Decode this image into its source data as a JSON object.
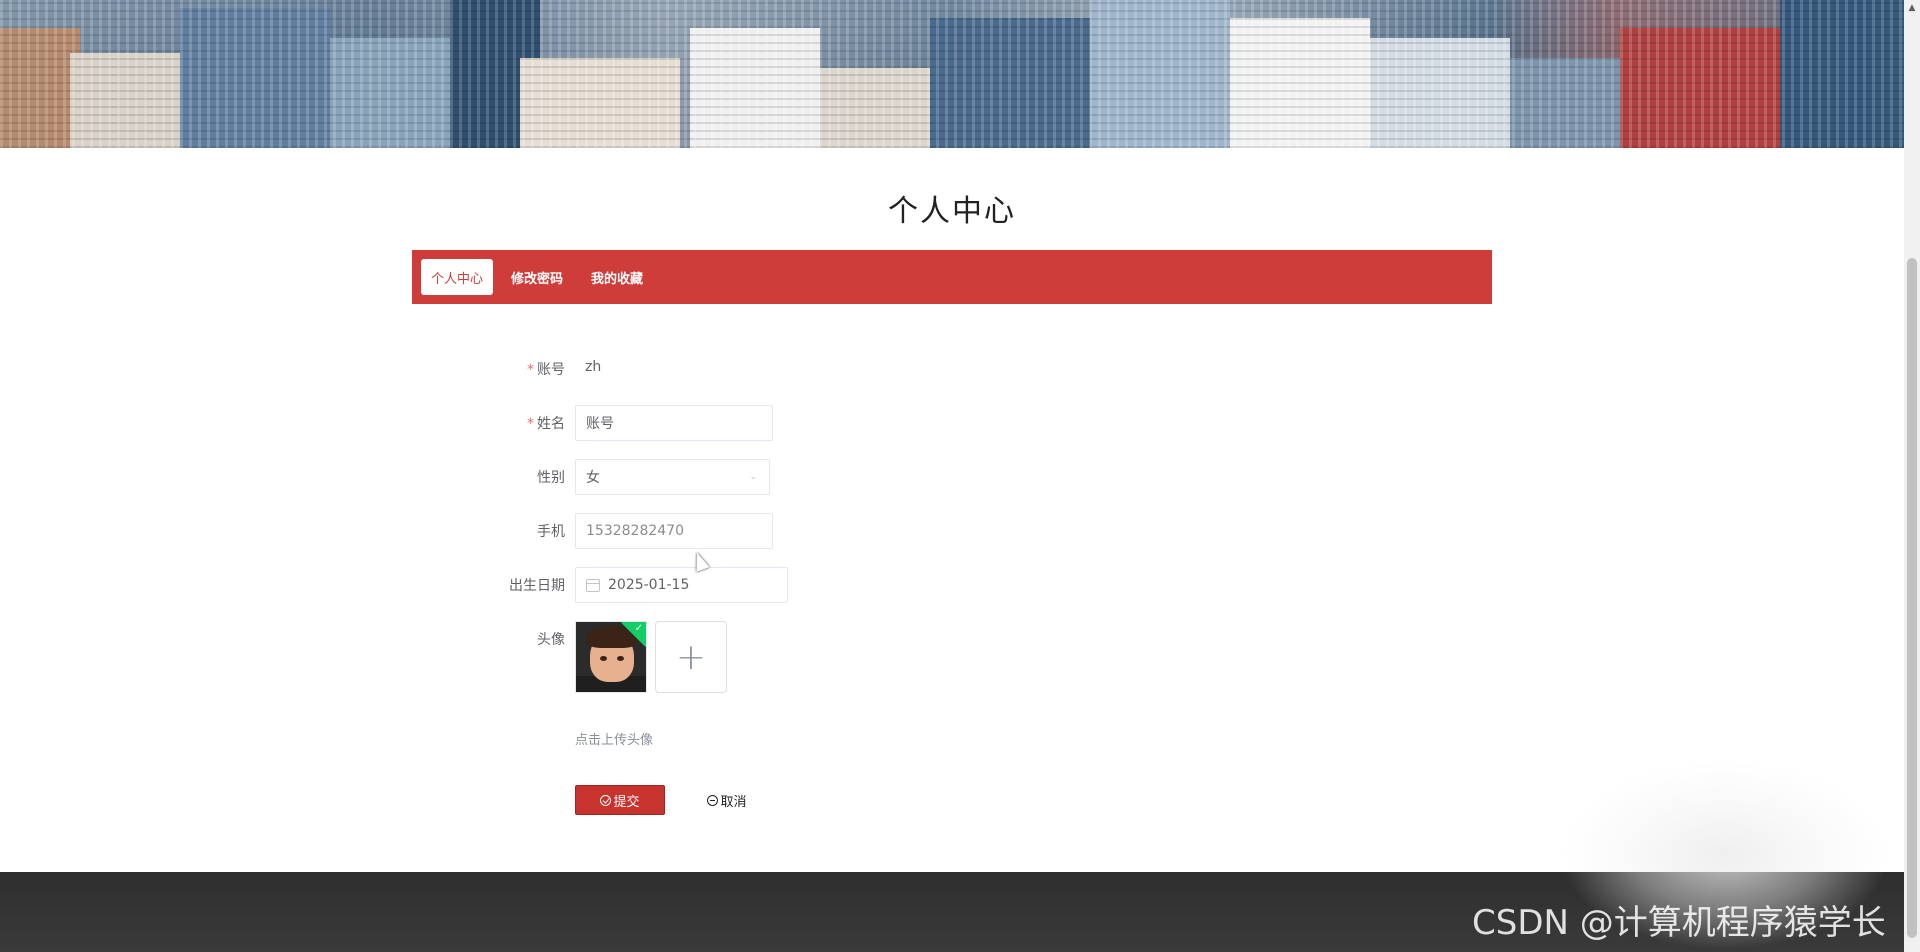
{
  "page": {
    "title": "个人中心"
  },
  "tabs": [
    {
      "label": "个人中心",
      "active": true
    },
    {
      "label": "修改密码",
      "active": false
    },
    {
      "label": "我的收藏",
      "active": false
    }
  ],
  "form": {
    "account": {
      "label": "账号",
      "required": true,
      "value": "zh"
    },
    "name": {
      "label": "姓名",
      "required": true,
      "value": "账号"
    },
    "gender": {
      "label": "性别",
      "value": "女"
    },
    "phone": {
      "label": "手机",
      "value": "15328282470"
    },
    "birthday": {
      "label": "出生日期",
      "value": "2025-01-15"
    },
    "avatar": {
      "label": "头像",
      "upload_hint": "点击上传头像",
      "plus": "+"
    }
  },
  "actions": {
    "submit": "提交",
    "cancel": "取消"
  },
  "watermark": "CSDN @计算机程序猿学长",
  "colors": {
    "accent": "#cf3d3b",
    "submit": "#c8332e",
    "success_badge": "#13ce66"
  }
}
